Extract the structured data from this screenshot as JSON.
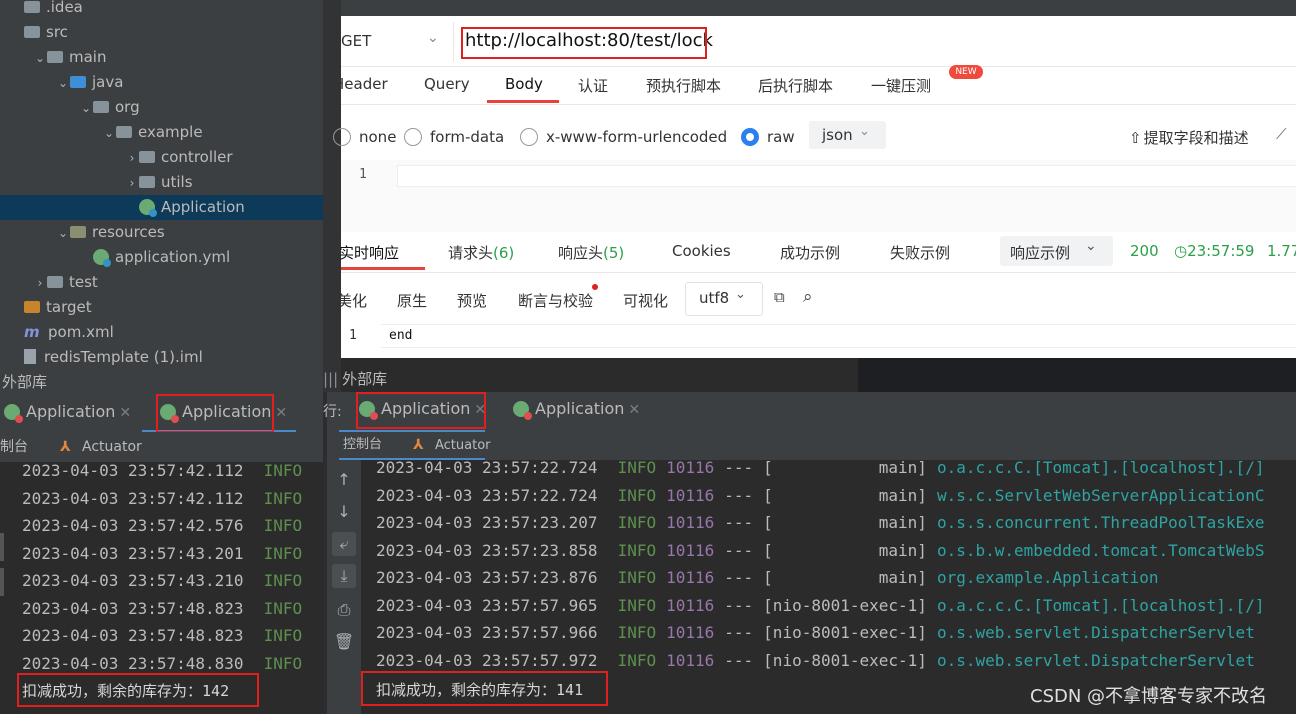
{
  "tree": [
    {
      "label": ".idea",
      "indent": 0,
      "kind": "folder",
      "chev": ""
    },
    {
      "label": "src",
      "indent": 0,
      "kind": "folder",
      "chev": ""
    },
    {
      "label": "main",
      "indent": 1,
      "kind": "folder",
      "chev": "⌄"
    },
    {
      "label": "java",
      "indent": 2,
      "kind": "folder-blue",
      "chev": "⌄"
    },
    {
      "label": "org",
      "indent": 3,
      "kind": "folder",
      "chev": "⌄"
    },
    {
      "label": "example",
      "indent": 4,
      "kind": "folder",
      "chev": "⌄"
    },
    {
      "label": "controller",
      "indent": 5,
      "kind": "folder",
      "chev": "›"
    },
    {
      "label": "utils",
      "indent": 5,
      "kind": "folder",
      "chev": "›"
    },
    {
      "label": "Application",
      "indent": 5,
      "kind": "spring",
      "chev": "",
      "selected": true
    },
    {
      "label": "resources",
      "indent": 2,
      "kind": "folder-res",
      "chev": "⌄"
    },
    {
      "label": "application.yml",
      "indent": 3,
      "kind": "spring",
      "chev": ""
    },
    {
      "label": "test",
      "indent": 1,
      "kind": "folder",
      "chev": "›"
    },
    {
      "label": "target",
      "indent": 0,
      "kind": "folder-orange",
      "chev": ""
    },
    {
      "label": "pom.xml",
      "indent": 0,
      "kind": "maven",
      "chev": ""
    },
    {
      "label": "redisTemplate (1).iml",
      "indent": 0,
      "kind": "iml",
      "chev": ""
    }
  ],
  "external_libs": "外部库",
  "left_run": {
    "tabs": [
      "Application",
      "Application"
    ],
    "sub_console": "制台",
    "sub_actuator": "Actuator",
    "log_times": [
      "2023-04-03 23:57:42.112",
      "2023-04-03 23:57:42.112",
      "2023-04-03 23:57:42.576",
      "2023-04-03 23:57:43.201",
      "2023-04-03 23:57:43.210",
      "2023-04-03 23:57:48.823",
      "2023-04-03 23:57:48.823",
      "2023-04-03 23:57:48.830"
    ],
    "level": "INFO",
    "result": "扣减成功，剩余的库存为：142"
  },
  "right_run": {
    "run_prefix": "行:",
    "tabs": [
      "Application",
      "Application"
    ],
    "sub_console": "控制台",
    "sub_actuator": "Actuator",
    "logs": [
      {
        "time": "2023-04-03 23:57:22.724",
        "level": "INFO",
        "pid": "10116",
        "sep": "---",
        "thread": "[           main]",
        "cls": "o.a.c.c.C.[Tomcat].[localhost].[/]"
      },
      {
        "time": "2023-04-03 23:57:22.724",
        "level": "INFO",
        "pid": "10116",
        "sep": "---",
        "thread": "[           main]",
        "cls": "w.s.c.ServletWebServerApplicationC"
      },
      {
        "time": "2023-04-03 23:57:23.207",
        "level": "INFO",
        "pid": "10116",
        "sep": "---",
        "thread": "[           main]",
        "cls": "o.s.s.concurrent.ThreadPoolTaskExe"
      },
      {
        "time": "2023-04-03 23:57:23.858",
        "level": "INFO",
        "pid": "10116",
        "sep": "---",
        "thread": "[           main]",
        "cls": "o.s.b.w.embedded.tomcat.TomcatWebS"
      },
      {
        "time": "2023-04-03 23:57:23.876",
        "level": "INFO",
        "pid": "10116",
        "sep": "---",
        "thread": "[           main]",
        "cls": "org.example.Application"
      },
      {
        "time": "2023-04-03 23:57:57.965",
        "level": "INFO",
        "pid": "10116",
        "sep": "---",
        "thread": "[nio-8001-exec-1]",
        "cls": "o.a.c.c.C.[Tomcat].[localhost].[/]"
      },
      {
        "time": "2023-04-03 23:57:57.966",
        "level": "INFO",
        "pid": "10116",
        "sep": "---",
        "thread": "[nio-8001-exec-1]",
        "cls": "o.s.web.servlet.DispatcherServlet"
      },
      {
        "time": "2023-04-03 23:57:57.972",
        "level": "INFO",
        "pid": "10116",
        "sep": "---",
        "thread": "[nio-8001-exec-1]",
        "cls": "o.s.web.servlet.DispatcherServlet"
      }
    ],
    "result": "扣减成功，剩余的库存为：141"
  },
  "api": {
    "method": "GET",
    "url": "http://localhost:80/test/lock",
    "req_tabs": [
      "Header",
      "Query",
      "Body",
      "认证",
      "预执行脚本",
      "后执行脚本",
      "一键压测"
    ],
    "new_badge": "NEW",
    "body_types": [
      "none",
      "form-data",
      "x-www-form-urlencoded",
      "raw"
    ],
    "format": "json",
    "extract": "提取字段和描述",
    "editor_line": "1",
    "resp_tabs": [
      "实时响应",
      "请求头(6)",
      "响应头(5)",
      "Cookies",
      "成功示例",
      "失败示例"
    ],
    "resp_example": "响应示例",
    "status": "200",
    "time": "23:57:59",
    "size": "1.77",
    "view_tabs": [
      "美化",
      "原生",
      "预览",
      "断言与校验",
      "可视化"
    ],
    "encoding": "utf8",
    "resp_line": "1",
    "resp_body": "end"
  },
  "watermark": "CSDN @不拿博客专家不改名"
}
